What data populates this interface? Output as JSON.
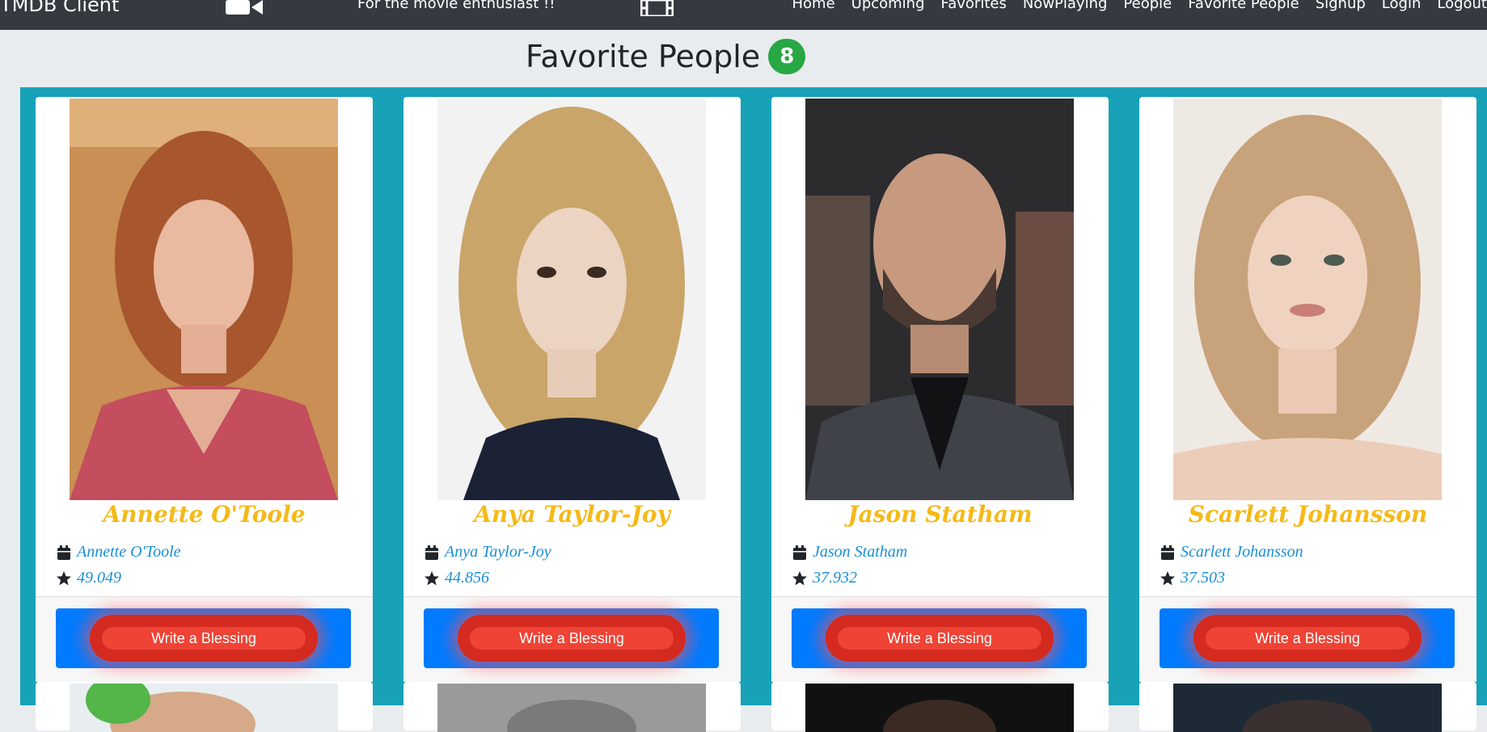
{
  "navbar": {
    "brand": "TMDB Client",
    "tagline": "For the movie enthusiast !!",
    "video_icon": "video-camera-icon",
    "film_icon": "film-icon",
    "links": [
      "Home",
      "Upcoming",
      "Favorites",
      "NowPlaying",
      "People",
      "Favorite People",
      "Signup",
      "Login",
      "Logout"
    ]
  },
  "heading": {
    "title": "Favorite People",
    "count": "8",
    "badge_color": "#28a745"
  },
  "colors": {
    "panel": "#17a2b8",
    "name_title": "#f5b918",
    "meta_text": "#1a8fd6",
    "button_bg": "#007bff",
    "blessing": "#d42a1f"
  },
  "cards": [
    {
      "title": "Annette O'Toole",
      "name": "Annette O'Toole",
      "popularity": "49.049",
      "button": "Write a Blessing"
    },
    {
      "title": "Anya Taylor-Joy",
      "name": "Anya Taylor-Joy",
      "popularity": "44.856",
      "button": "Write a Blessing"
    },
    {
      "title": "Jason Statham",
      "name": "Jason Statham",
      "popularity": "37.932",
      "button": "Write a Blessing"
    },
    {
      "title": "Scarlett Johansson",
      "name": "Scarlett Johansson",
      "popularity": "37.503",
      "button": "Write a Blessing"
    }
  ],
  "icons": {
    "name_icon": "calendar-icon",
    "popularity_icon": "star-icon"
  }
}
